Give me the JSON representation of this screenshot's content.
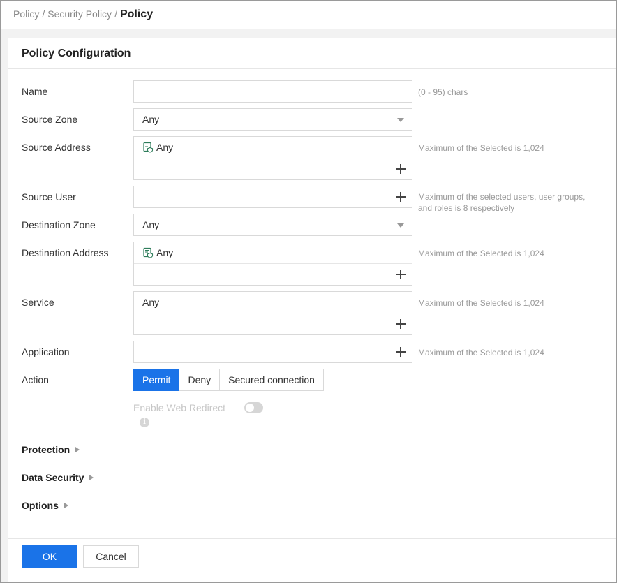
{
  "breadcrumb": {
    "items": [
      "Policy",
      "Security Policy"
    ],
    "separator": "/",
    "current": "Policy"
  },
  "panel": {
    "title": "Policy Configuration"
  },
  "form": {
    "name": {
      "label": "Name",
      "value": "",
      "hint": "(0 - 95) chars"
    },
    "source_zone": {
      "label": "Source Zone",
      "value": "Any"
    },
    "source_address": {
      "label": "Source Address",
      "tag": "Any",
      "hint": "Maximum of the Selected is 1,024"
    },
    "source_user": {
      "label": "Source User",
      "hint": "Maximum of the selected users, user groups, and roles is 8 respectively"
    },
    "destination_zone": {
      "label": "Destination Zone",
      "value": "Any"
    },
    "destination_address": {
      "label": "Destination Address",
      "tag": "Any",
      "hint": "Maximum of the Selected is 1,024"
    },
    "service": {
      "label": "Service",
      "tag": "Any",
      "hint": "Maximum of the Selected is 1,024"
    },
    "application": {
      "label": "Application",
      "hint": "Maximum of the Selected is 1,024"
    },
    "action": {
      "label": "Action",
      "options": [
        "Permit",
        "Deny",
        "Secured connection"
      ],
      "selected": "Permit"
    },
    "web_redirect": {
      "label": "Enable Web Redirect",
      "enabled": false,
      "info_icon": "info-icon"
    }
  },
  "sections": [
    "Protection",
    "Data Security",
    "Options"
  ],
  "footer": {
    "ok": "OK",
    "cancel": "Cancel"
  },
  "colors": {
    "primary": "#1a73e8",
    "address_icon": "#2e7d5b"
  }
}
